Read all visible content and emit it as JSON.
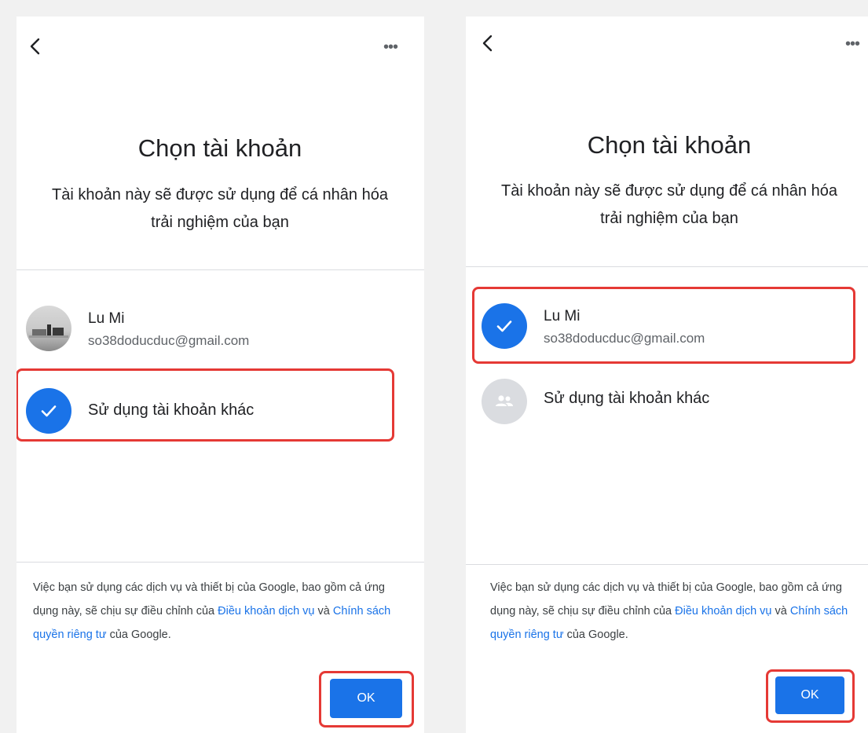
{
  "screens": [
    {
      "title": "Chọn tài khoản",
      "subtitle": "Tài khoản này sẽ được sử dụng để cá nhân hóa trải nghiệm của bạn",
      "account": {
        "name": "Lu Mi",
        "email": "so38doducduc@gmail.com",
        "selected": false
      },
      "other_account": {
        "label": "Sử dụng tài khoản khác",
        "selected": true
      },
      "footer": {
        "text_1": "Việc bạn sử dụng các dịch vụ và thiết bị của Google, bao gồm cả ứng dụng này, sẽ chịu sự điều chỉnh của ",
        "terms_link": "Điều khoản dịch vụ",
        "text_2": " và ",
        "privacy_link": "Chính sách quyền riêng tư",
        "text_3": " của Google."
      },
      "ok_label": "OK"
    },
    {
      "title": "Chọn tài khoản",
      "subtitle": "Tài khoản này sẽ được sử dụng để cá nhân hóa trải nghiệm của bạn",
      "account": {
        "name": "Lu Mi",
        "email": "so38doducduc@gmail.com",
        "selected": true
      },
      "other_account": {
        "label": "Sử dụng tài khoản khác",
        "selected": false
      },
      "footer": {
        "text_1": "Việc bạn sử dụng các dịch vụ và thiết bị của Google, bao gồm cả ứng dụng này, sẽ chịu sự điều chỉnh của ",
        "terms_link": "Điều khoản dịch vụ",
        "text_2": " và ",
        "privacy_link": "Chính sách quyền riêng tư",
        "text_3": " của Google."
      },
      "ok_label": "OK"
    }
  ],
  "icons": {
    "back": "back-arrow-icon",
    "more": "more-options-icon",
    "check": "checkmark-icon",
    "people": "people-icon"
  },
  "more_glyph": "•••",
  "colors": {
    "accent": "#1a73e8",
    "highlight": "#e53935",
    "divider": "#dadce0"
  }
}
